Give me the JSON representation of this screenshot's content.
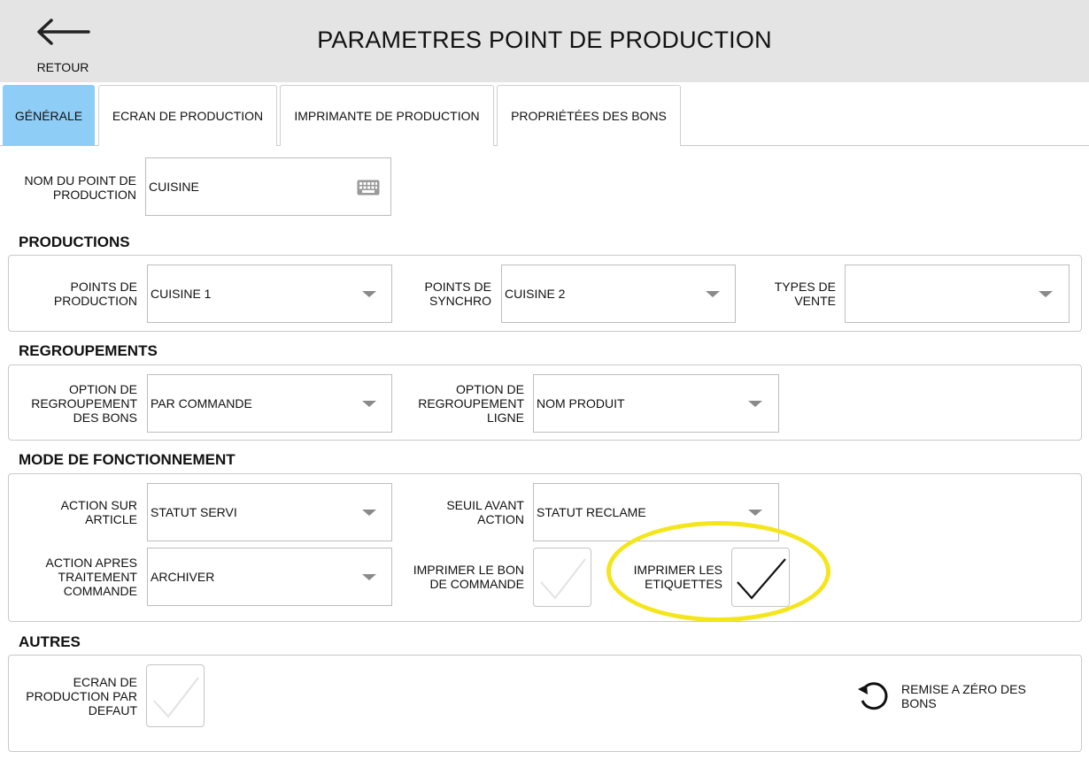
{
  "header": {
    "back_label": "RETOUR",
    "title": "PARAMETRES POINT DE PRODUCTION"
  },
  "tabs": [
    {
      "label": "GÉNÉRALE",
      "active": true
    },
    {
      "label": "ECRAN DE PRODUCTION",
      "active": false
    },
    {
      "label": "IMPRIMANTE DE PRODUCTION",
      "active": false
    },
    {
      "label": "PROPRIÉTÉES DES BONS",
      "active": false
    }
  ],
  "general": {
    "name_label_line1": "NOM DU POINT DE",
    "name_label_line2": "PRODUCTION",
    "name_value": "CUISINE",
    "name_icon": "keyboard-icon"
  },
  "productions": {
    "title": "PRODUCTIONS",
    "points_label_line1": "POINTS DE",
    "points_label_line2": "PRODUCTION",
    "points_value": "CUISINE 1",
    "synchro_label_line1": "POINTS DE",
    "synchro_label_line2": "SYNCHRO",
    "synchro_value": "CUISINE 2",
    "types_label_line1": "TYPES DE",
    "types_label_line2": "VENTE",
    "types_value": ""
  },
  "regroupements": {
    "title": "REGROUPEMENTS",
    "bons_label_line1": "OPTION DE",
    "bons_label_line2": "REGROUPEMENT",
    "bons_label_line3": "DES BONS",
    "bons_value": "PAR COMMANDE",
    "ligne_label_line1": "OPTION DE",
    "ligne_label_line2": "REGROUPEMENT",
    "ligne_label_line3": "LIGNE",
    "ligne_value": "NOM PRODUIT"
  },
  "mode": {
    "title": "MODE DE FONCTIONNEMENT",
    "action_article_label_line1": "ACTION SUR",
    "action_article_label_line2": "ARTICLE",
    "action_article_value": "STATUT SERVI",
    "seuil_label_line1": "SEUIL AVANT",
    "seuil_label_line2": "ACTION",
    "seuil_value": "STATUT RECLAME",
    "action_apres_label_line1": "ACTION APRES",
    "action_apres_label_line2": "TRAITEMENT",
    "action_apres_label_line3": "COMMANDE",
    "action_apres_value": "ARCHIVER",
    "print_bon_label_line1": "IMPRIMER LE BON",
    "print_bon_label_line2": "DE COMMANDE",
    "print_bon_checked": false,
    "print_labels_label_line1": "IMPRIMER LES",
    "print_labels_label_line2": "ETIQUETTES",
    "print_labels_checked": true
  },
  "autres": {
    "title": "AUTRES",
    "default_screen_label_line1": "ECRAN DE",
    "default_screen_label_line2": "PRODUCTION PAR",
    "default_screen_label_line3": "DEFAUT",
    "default_screen_checked": false,
    "reset_label_line1": "REMISE A ZÉRO DES",
    "reset_label_line2": "BONS",
    "reset_icon": "reset-icon"
  },
  "colors": {
    "header_bg": "#e4e4e4",
    "active_tab": "#8ecdf6",
    "highlight": "#f4e61b"
  }
}
